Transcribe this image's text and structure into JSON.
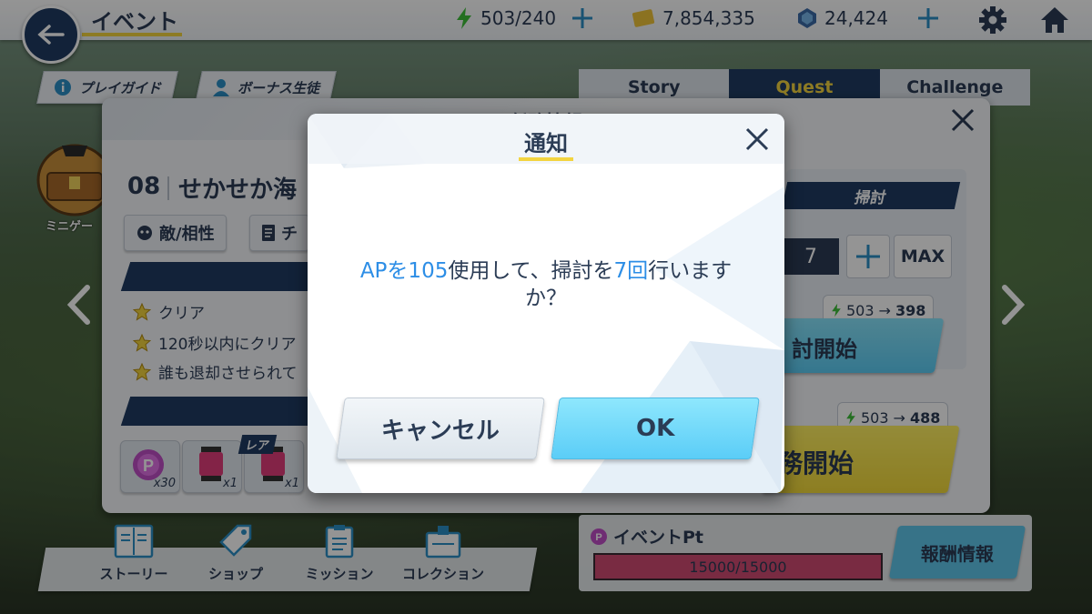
{
  "topbar": {
    "title": "イベント",
    "ap": "503/240",
    "credits": "7,854,335",
    "gems": "24,424"
  },
  "chips": {
    "guide": "プレイガイド",
    "bonus": "ボーナス生徒"
  },
  "tabs": [
    {
      "label": "Story"
    },
    {
      "label": "Quest"
    },
    {
      "label": "Challenge"
    }
  ],
  "mission": {
    "header_title": "任務情報",
    "stage_number": "08",
    "stage_name": "せかせか海",
    "enemy_button": "敵/相性",
    "other_button": "チ",
    "goals": [
      "クリア",
      "120秒以内にクリア",
      "誰も退却させられて"
    ],
    "items": [
      {
        "count": "x30"
      },
      {
        "count": "x1"
      },
      {
        "count": "x1"
      }
    ],
    "rare_tag": "レア",
    "minigame_label": "ミニゲー"
  },
  "sweep": {
    "header": "掃討",
    "count": "7",
    "max_label": "MAX",
    "sweep_cost_from": "503",
    "sweep_cost_to": "398",
    "sweep_button": "討開始",
    "start_cost_from": "503",
    "start_cost_to": "488",
    "start_button": "務開始"
  },
  "bottom_nav": [
    {
      "label": "ストーリー"
    },
    {
      "label": "ショップ"
    },
    {
      "label": "ミッション"
    },
    {
      "label": "コレクション"
    }
  ],
  "event_pt": {
    "label": "イベントPt",
    "value": "15000/15000",
    "fill_fraction": 1.0,
    "reward_button": "報酬情報"
  },
  "dialog": {
    "title": "通知",
    "message_part1": "APを105",
    "message_part2": "使用して、掃討を",
    "message_part3": "7回",
    "message_part4": "行いますか？",
    "cancel_label": "キャンセル",
    "ok_label": "OK"
  },
  "colors": {
    "navy": "#1f3c62",
    "accent_yellow": "#f3d43f",
    "highlight_blue": "#2d8ee6",
    "ok_cyan": "#5bcdf7",
    "ap_green": "#3fbf3a",
    "event_pink": "#d14a72"
  },
  "icons": {
    "back": "arrow-left-icon",
    "ap": "lightning-icon",
    "credits": "credit-card-icon",
    "gems": "gem-icon",
    "settings": "gear-icon",
    "home": "home-icon",
    "close": "close-icon"
  }
}
